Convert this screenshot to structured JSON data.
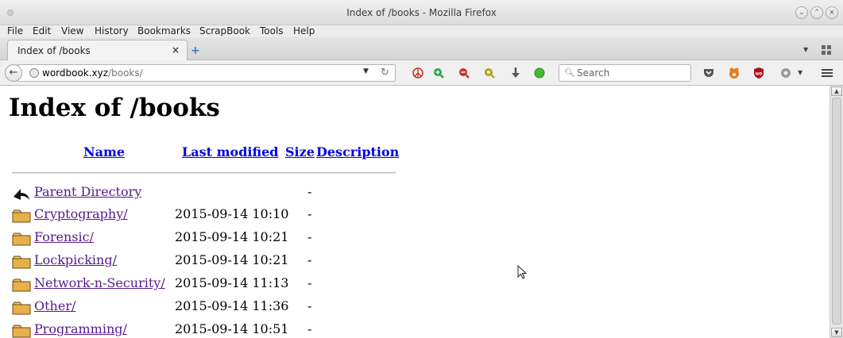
{
  "window": {
    "title": "Index of /books - Mozilla Firefox",
    "controls": [
      "minimize",
      "maximize",
      "close"
    ]
  },
  "menubar": {
    "items": [
      "File",
      "Edit",
      "View",
      "History",
      "Bookmarks",
      "ScrapBook",
      "Tools",
      "Help"
    ]
  },
  "tabs": [
    {
      "label": "Index of /books",
      "close": "×"
    }
  ],
  "toolbar": {
    "new_tab": "+",
    "url_host": "wordbook.xyz",
    "url_path": "/books/",
    "search_placeholder": "Search",
    "icons": [
      "back-arrow-icon",
      "globe-icon",
      "reload-icon",
      "peace-icon",
      "zoom-in-icon",
      "zoom-out-icon",
      "zoom-reset-icon",
      "download-icon",
      "green-dot-icon",
      "pocket-icon",
      "addon-icon",
      "ublock-icon",
      "extension-icon",
      "menu-icon"
    ]
  },
  "page": {
    "title": "Index of /books",
    "columns": {
      "name": "Name",
      "last_modified": "Last modified",
      "size": "Size",
      "description": "Description"
    },
    "rows": [
      {
        "icon": "back-icon",
        "name": "Parent Directory",
        "date": "",
        "size": "-"
      },
      {
        "icon": "folder-icon",
        "name": "Cryptography/",
        "date": "2015-09-14 10:10",
        "size": "-"
      },
      {
        "icon": "folder-icon",
        "name": "Forensic/",
        "date": "2015-09-14 10:21",
        "size": "-"
      },
      {
        "icon": "folder-icon",
        "name": "Lockpicking/",
        "date": "2015-09-14 10:21",
        "size": "-"
      },
      {
        "icon": "folder-icon",
        "name": "Network-n-Security/",
        "date": "2015-09-14 11:13",
        "size": "-"
      },
      {
        "icon": "folder-icon",
        "name": "Other/",
        "date": "2015-09-14 11:36",
        "size": "-"
      },
      {
        "icon": "folder-icon",
        "name": "Programming/",
        "date": "2015-09-14 10:51",
        "size": "-"
      }
    ]
  },
  "colors": {
    "link": "#0000ee",
    "visited_link": "#551a8b",
    "folder": "#e8b04a"
  }
}
